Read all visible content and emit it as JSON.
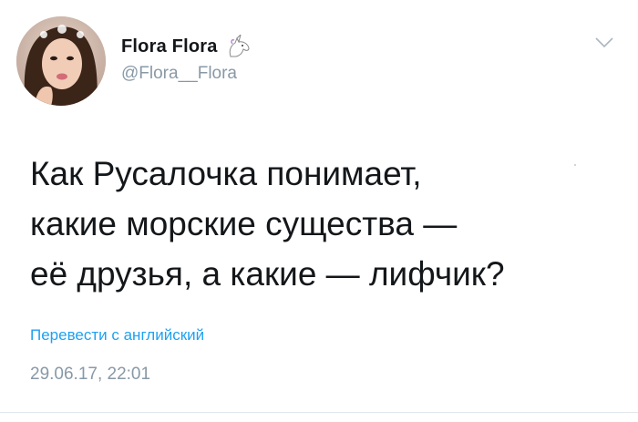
{
  "tweet": {
    "author": {
      "display_name": "Flora Flora",
      "handle": "@Flora__Flora",
      "name_emoji": "unicorn-icon",
      "avatar": "avatar"
    },
    "menu_icon": "chevron-down-icon",
    "text_lines": [
      "Как Русалочка понимает,",
      "какие морские существа —",
      "её друзья, а какие — лифчик?"
    ],
    "translate_label": "Перевести с английский",
    "timestamp": "29.06.17, 22:01"
  },
  "colors": {
    "text": "#14171a",
    "secondary": "#8899a6",
    "link": "#1da1f2",
    "background": "#ffffff"
  }
}
